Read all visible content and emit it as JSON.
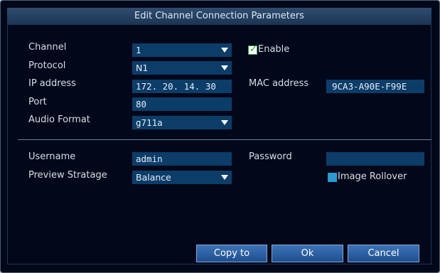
{
  "window": {
    "title": "Edit Channel Connection Parameters"
  },
  "fields": {
    "channel": {
      "label": "Channel",
      "value": "1"
    },
    "enable": {
      "label": "Enable",
      "checked": true
    },
    "protocol": {
      "label": "Protocol",
      "value": "N1"
    },
    "ip_address": {
      "label": "IP address",
      "value": "172. 20. 14. 30"
    },
    "mac_address": {
      "label": "MAC address",
      "value": "9CA3-A90E-F99E"
    },
    "port": {
      "label": "Port",
      "value": "80"
    },
    "audio_format": {
      "label": "Audio Format",
      "value": "g711a"
    },
    "username": {
      "label": "Username",
      "value": "admin"
    },
    "password": {
      "label": "Password",
      "value": ""
    },
    "preview_strategy": {
      "label": "Preview Stratage",
      "value": "Balance"
    },
    "image_rollover": {
      "label": "Image Rollover",
      "checked": false
    }
  },
  "buttons": {
    "copy_to": "Copy to",
    "ok": "Ok",
    "cancel": "Cancel"
  },
  "colors": {
    "field_bg": "#0c3d69",
    "dialog_bg": "#03071a",
    "title_bg": "#2f4d6f",
    "button_bg": "#2f62a6"
  }
}
